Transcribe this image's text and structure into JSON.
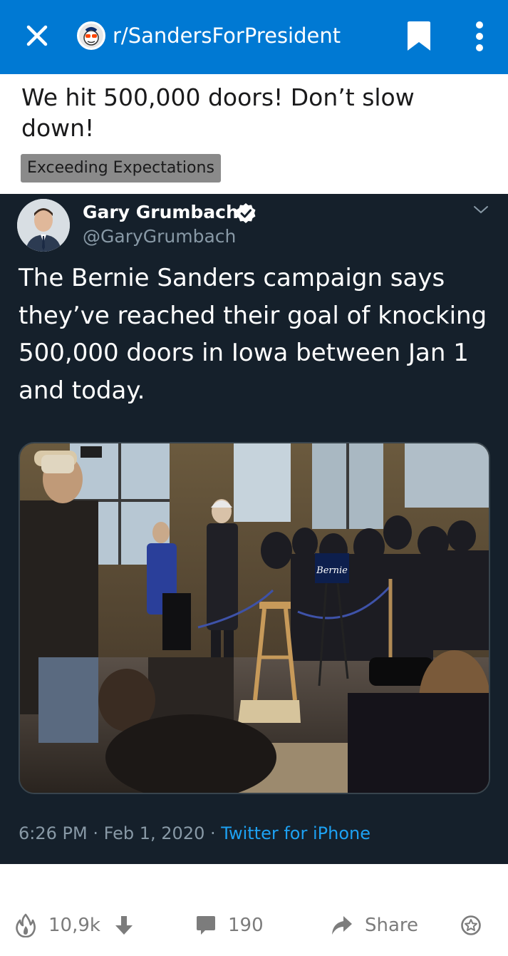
{
  "topbar": {
    "subreddit": "r/SandersForPresident",
    "close_icon": "close-icon",
    "bookmark_icon": "bookmark-icon",
    "more_icon": "more-vertical-icon",
    "bg_color": "#0079d3"
  },
  "post": {
    "title": "We hit 500,000 doors! Don’t slow down!",
    "flair": "Exceeding Expectations"
  },
  "tweet": {
    "author_name": "Gary Grumbach",
    "handle": "@GaryGrumbach",
    "text": "The Bernie Sanders campaign says they’ve reached their goal of knocking 500,000 doors in Iowa between Jan 1 and today.",
    "time": "6:26 PM",
    "separator": "·",
    "date": "Feb 1, 2020",
    "source": "Twitter for iPhone",
    "sign_text": "Bernie",
    "bg_color": "#15202b",
    "link_color": "#1da1f2"
  },
  "actions": {
    "votes": "10,9k",
    "comments": "190",
    "share": "Share",
    "upvote_icon": "flame-upvote-icon",
    "downvote_icon": "downvote-arrow-icon",
    "comment_icon": "comment-bubble-icon",
    "share_icon": "share-arrow-icon",
    "award_icon": "award-icon"
  }
}
